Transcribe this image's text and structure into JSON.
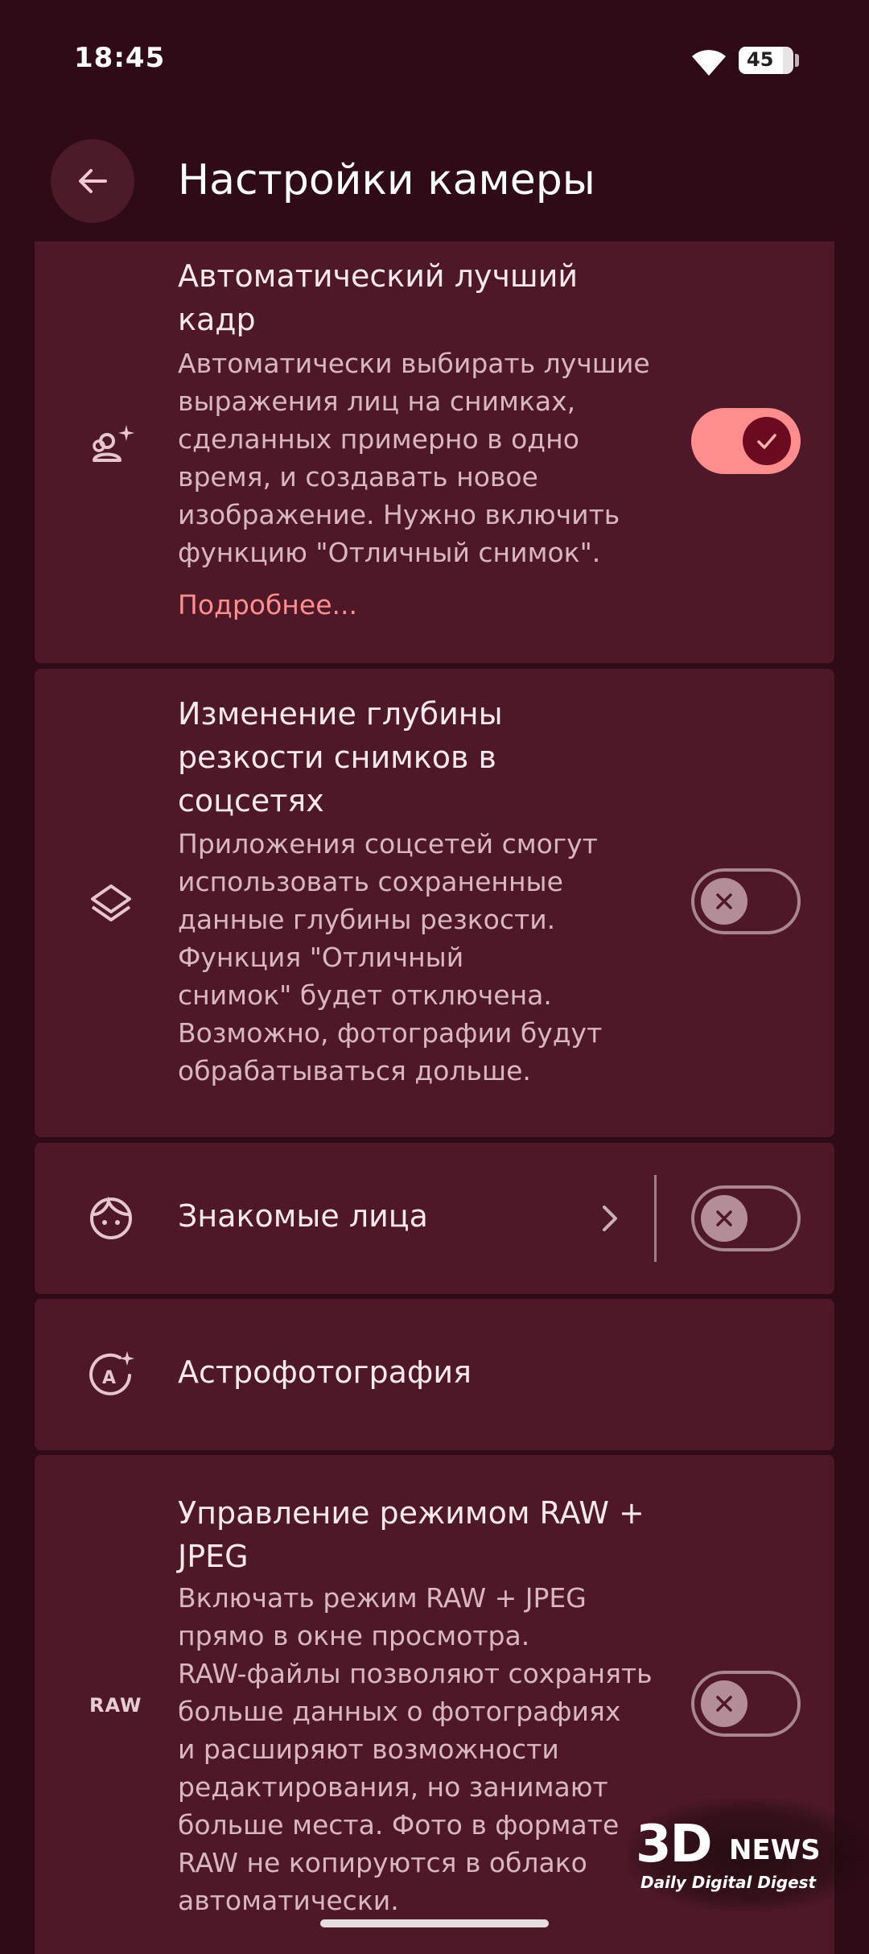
{
  "status_bar": {
    "time": "18:45",
    "battery": "45"
  },
  "header": {
    "title": "Настройки камеры"
  },
  "settings": [
    {
      "title": "Автоматический лучший\nкадр",
      "description": "Автоматически выбирать лучшие\nвыражения лиц на снимках,\nсделанных примерно в одно\nвремя, и создавать новое\nизображение. Нужно включить\nфункцию \"Отличный снимок\".",
      "link": "Подробнее...",
      "icon": "face-sparkle-icon",
      "enabled": true
    },
    {
      "title": "Изменение глубины\nрезкости снимков в\nсоцсетях",
      "description": "Приложения соцсетей смогут\nиспользовать сохраненные\nданные глубины резкости.\nФункция \"Отличный\nснимок\" будет отключена.\nВозможно, фотографии будут\nобрабатываться дольше.",
      "icon": "layers-icon",
      "enabled": false
    },
    {
      "title": "Знакомые лица",
      "icon": "face-icon",
      "enabled": false
    },
    {
      "title": "Астрофотография",
      "icon": "astro-icon"
    },
    {
      "title": "Управление режимом RAW +\nJPEG",
      "description": "Включать режим RAW + JPEG\nпрямо в окне просмотра.\nRAW-файлы позволяют сохранять\nбольше данных о фотографиях\nи расширяют возможности\nредактирования, но занимают\nбольше места. Фото в формате\nRAW не копируются в облако\nавтоматически.",
      "icon_label": "RAW",
      "enabled": false
    }
  ],
  "watermark": {
    "brand": "3D",
    "brand_suffix": "NEWS",
    "tagline": "Daily Digital Digest"
  }
}
